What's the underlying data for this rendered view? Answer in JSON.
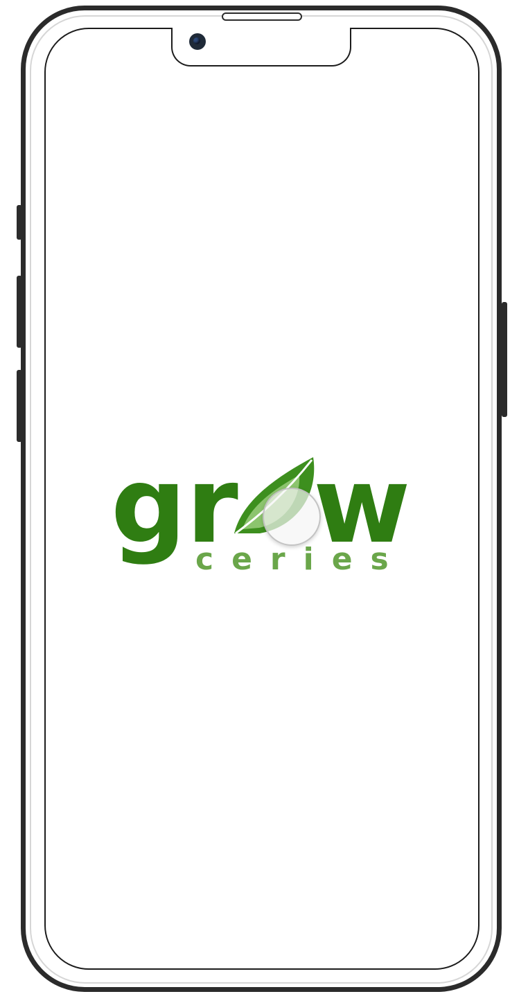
{
  "device": {
    "type": "smartphone",
    "frame_color": "#2b2b2b"
  },
  "splash": {
    "logo_word": "grow",
    "logo_subtitle": "ceries",
    "brand_color": "#2f7d12",
    "subtitle_color": "#6aa64a",
    "leaf_color": "#3d8f1e"
  },
  "touch_indicator": {
    "visible": true
  }
}
